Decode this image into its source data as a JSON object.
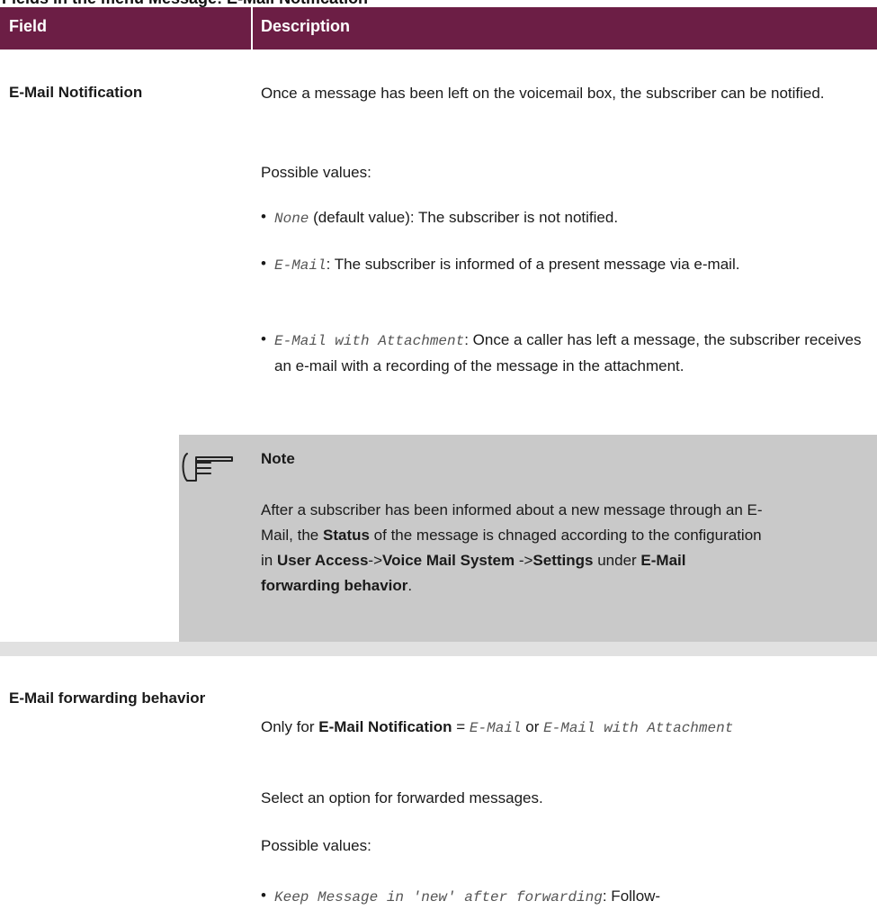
{
  "caption": "Fields in the menu Message: E-Mail Notification",
  "header": {
    "field": "Field",
    "description": "Description"
  },
  "row1": {
    "field": "E-Mail Notification",
    "desc_line": "Once a message has been left on the voicemail box, the subscriber can be notified.",
    "possible_values": "Possible values:",
    "opt1_code": "None",
    "opt1_text": " (default value): The subscriber is not notified.",
    "opt2_code": "E-Mail",
    "opt2_text": ": The subscriber is informed of a present message via e-mail.",
    "opt3_code": "E-Mail with Attachment",
    "opt3_text": ": Once a caller has left a message, the subscriber receives an e-mail with a recording of the message in the attachment."
  },
  "note": {
    "title": "Note",
    "t1": "After a subscriber has been informed about a new message through an E-Mail, the ",
    "status": "Status",
    "t2": " of the message is chnaged according to the configuration in ",
    "path1": "User Access",
    "arrow1": "->",
    "path2": "Voice Mail System ",
    "arrow2": "->",
    "path3": "Settings",
    "t3": " under ",
    "target": "E-Mail forwarding behavior",
    "t4": "."
  },
  "row2": {
    "field": "E-Mail forwarding behavior",
    "only_for": "Only for ",
    "only_for_field": "E-Mail Notification",
    "eq": " = ",
    "code1": "E-Mail",
    "or": " or ",
    "code2": "E-Mail with Attachment",
    "select_text": "Select an option for forwarded messages.",
    "possible_values": "Possible values:",
    "opt1_code": "Keep Message in 'new' after forwarding",
    "opt1_text": ": Follow-"
  },
  "colors": {
    "header_bg": "#6c1e45",
    "note_bg": "#c9c9c9",
    "row_sep": "#e1e1e1"
  },
  "icons": {
    "note": "pointing-hand-icon"
  }
}
